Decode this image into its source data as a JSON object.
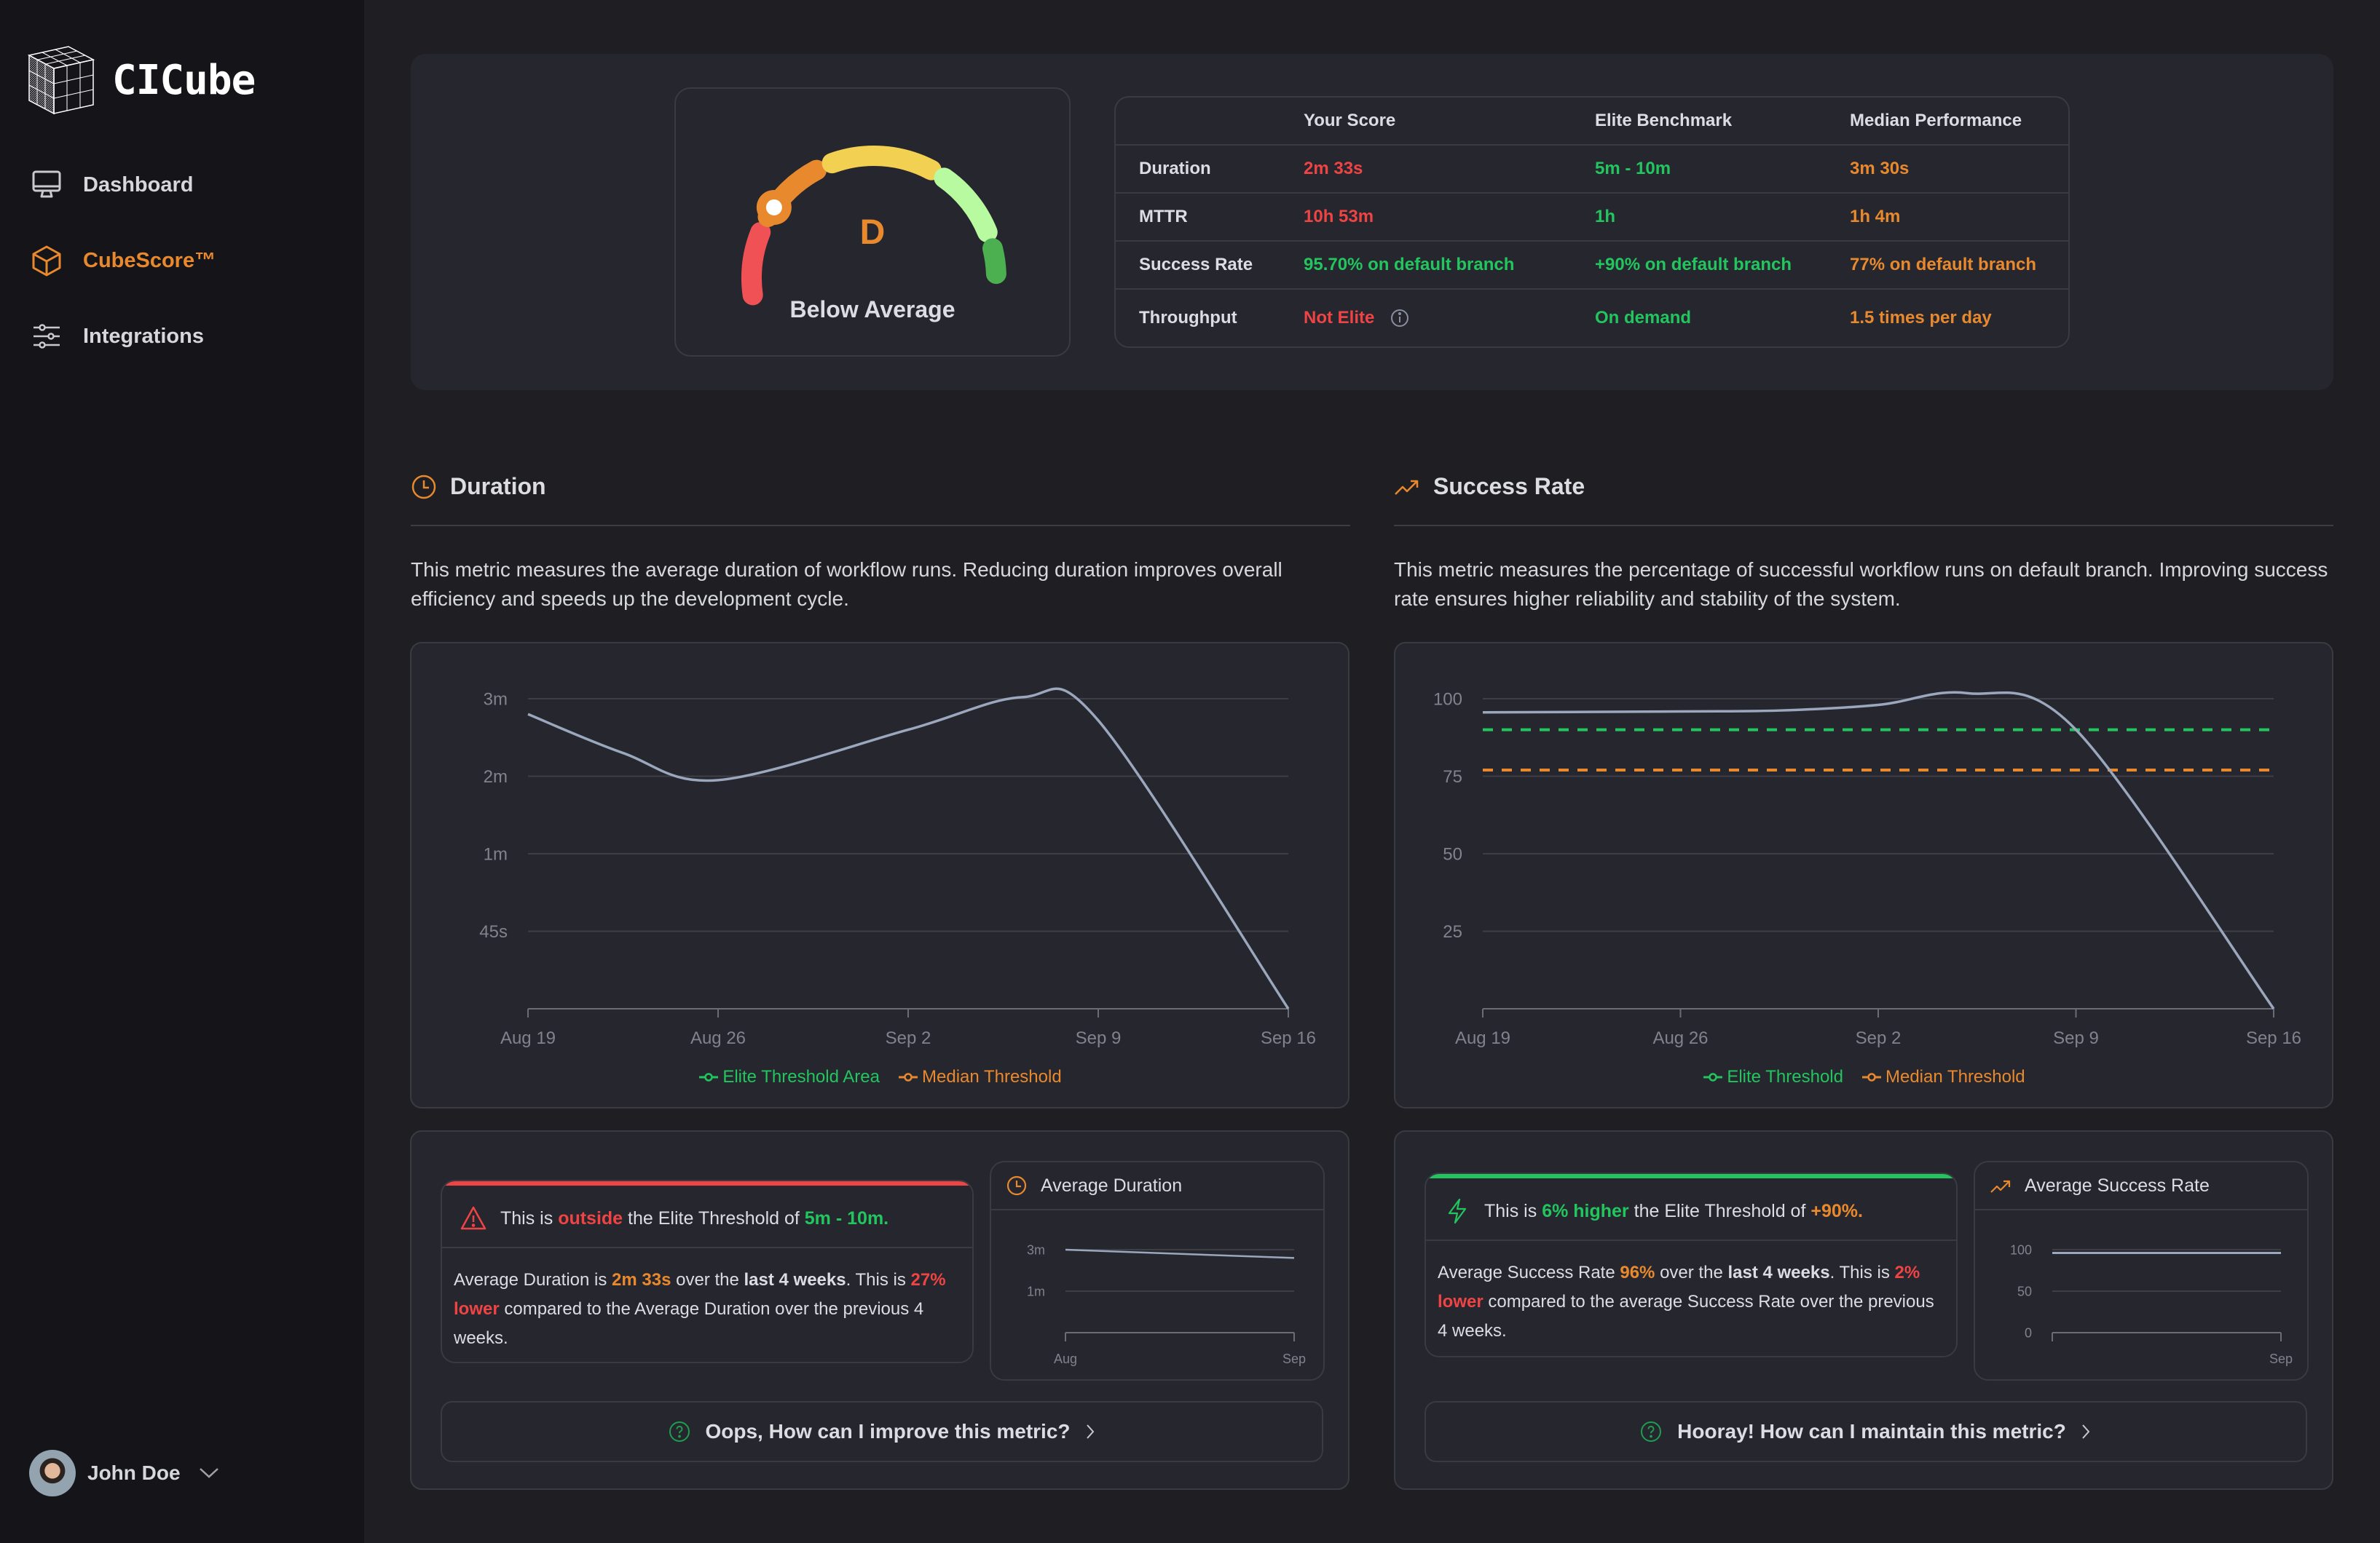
{
  "app": {
    "name": "CICube"
  },
  "sidebar": {
    "items": [
      {
        "label": "Dashboard",
        "icon": "monitor-icon",
        "active": false
      },
      {
        "label": "CubeScore™",
        "icon": "cube-icon",
        "active": true
      },
      {
        "label": "Integrations",
        "icon": "sliders-icon",
        "active": false
      }
    ],
    "user": {
      "name": "John Doe"
    }
  },
  "colors": {
    "accent": "#e8892e",
    "red": "#ef4444",
    "green": "#22c55e",
    "line": "#9aa7bd"
  },
  "score": {
    "grade": "D",
    "label": "Below Average",
    "gauge_segments": [
      {
        "name": "red",
        "color": "#ef5155"
      },
      {
        "name": "orange",
        "color": "#e8892e"
      },
      {
        "name": "yellow",
        "color": "#f2d052"
      },
      {
        "name": "light-green",
        "color": "#b7fa9f"
      },
      {
        "name": "green",
        "color": "#4caf50"
      }
    ],
    "gauge_value_fraction": 0.28,
    "table": {
      "headers": [
        "",
        "Your Score",
        "Elite Benchmark",
        "Median Performance"
      ],
      "rows": [
        {
          "metric": "Duration",
          "your": "2m 33s",
          "your_status": "red",
          "elite": "5m - 10m",
          "median": "3m 30s"
        },
        {
          "metric": "MTTR",
          "your": "10h 53m",
          "your_status": "red",
          "elite": "1h",
          "median": "1h 4m"
        },
        {
          "metric": "Success Rate",
          "your": "95.70% on default branch",
          "your_status": "green",
          "elite": "+90% on default branch",
          "median": "77% on default branch"
        },
        {
          "metric": "Throughput",
          "your": "Not Elite",
          "your_status": "red",
          "elite": "On demand",
          "median": "1.5 times per day",
          "info": true
        }
      ]
    }
  },
  "duration": {
    "title": "Duration",
    "description": "This metric measures the average duration of workflow runs. Reducing duration improves overall efficiency and speeds up the development cycle.",
    "alert": {
      "prefix": "This is ",
      "highlight": "outside",
      "middle": " the Elite Threshold of ",
      "threshold": "5m - 10m.",
      "body_1": "Average Duration is ",
      "value": "2m 33s",
      "body_2": " over the ",
      "period": "last 4 weeks",
      "body_3": ". This is ",
      "change": "27% lower",
      "body_4": " compared to the Average Duration over the previous 4 weeks."
    },
    "mini": {
      "title": "Average Duration"
    },
    "help_button": "Oops, How can I improve this metric?"
  },
  "success_rate": {
    "title": "Success Rate",
    "description": "This metric measures the percentage of successful workflow runs on default branch. Improving success rate ensures higher reliability and stability of the system.",
    "alert": {
      "prefix": "This is ",
      "highlight": "6% higher",
      "middle": " the Elite Threshold of ",
      "threshold": "+90%.",
      "body_1": "Average Success Rate ",
      "value": "96%",
      "body_2": " over the ",
      "period": "last 4 weeks",
      "body_3": ". This is ",
      "change": "2% lower",
      "body_4": " compared to the average Success Rate over the previous 4 weeks."
    },
    "mini": {
      "title": "Average Success Rate"
    },
    "help_button": "Hooray! How can I maintain this metric?"
  },
  "chart_data": [
    {
      "id": "duration-chart",
      "type": "line",
      "title": "Duration",
      "x": [
        "Aug 19",
        "Aug 26",
        "Sep 2",
        "Sep 9",
        "Sep 16"
      ],
      "ytick_labels": [
        "45s",
        "1m",
        "2m",
        "3m"
      ],
      "ytick_positions": [
        1,
        2,
        3,
        4
      ],
      "ylim": [
        0,
        4
      ],
      "series": [
        {
          "name": "Duration",
          "color": "#9aa7bd",
          "points": [
            [
              0,
              3.8
            ],
            [
              0.5,
              3.3
            ],
            [
              1,
              2.95
            ],
            [
              2,
              3.6
            ],
            [
              2.6,
              4.02
            ],
            [
              3,
              3.72
            ],
            [
              4,
              0
            ]
          ]
        }
      ],
      "legend": [
        {
          "label": "Elite Threshold Area",
          "color": "#22c55e"
        },
        {
          "label": "Median Threshold",
          "color": "#e8892e"
        }
      ],
      "legend_position": "bottom",
      "grid": true
    },
    {
      "id": "success-rate-chart",
      "type": "line",
      "title": "Success Rate",
      "x": [
        "Aug 19",
        "Aug 26",
        "Sep 2",
        "Sep 9",
        "Sep 16"
      ],
      "ytick_labels": [
        "25",
        "50",
        "75",
        "100"
      ],
      "ytick_positions": [
        25,
        50,
        75,
        100
      ],
      "ylim": [
        0,
        100
      ],
      "series": [
        {
          "name": "Success Rate",
          "color": "#9aa7bd",
          "points": [
            [
              0,
              95.6
            ],
            [
              1,
              95.9
            ],
            [
              1.5,
              96.2
            ],
            [
              2,
              98
            ],
            [
              2.45,
              101.8
            ],
            [
              3,
              90
            ],
            [
              4,
              0
            ]
          ]
        }
      ],
      "thresholds": [
        {
          "name": "Elite Threshold",
          "value": 90,
          "color": "#22c55e"
        },
        {
          "name": "Median Threshold",
          "value": 77,
          "color": "#e8892e"
        }
      ],
      "legend": [
        {
          "label": "Elite Threshold",
          "color": "#22c55e"
        },
        {
          "label": "Median Threshold",
          "color": "#e8892e"
        }
      ],
      "legend_position": "bottom",
      "grid": true
    },
    {
      "id": "mini-duration-chart",
      "type": "line",
      "title": "Average Duration",
      "x": [
        "Aug",
        "Sep"
      ],
      "ytick_labels": [
        "1m",
        "3m"
      ],
      "ytick_positions": [
        1,
        2
      ],
      "ylim": [
        0,
        2
      ],
      "series": [
        {
          "name": "Average Duration",
          "color": "#9aa7bd",
          "points": [
            [
              0,
              2.0
            ],
            [
              1,
              1.8
            ]
          ]
        }
      ],
      "grid": true
    },
    {
      "id": "mini-success-chart",
      "type": "line",
      "title": "Average Success Rate",
      "x": [
        "",
        "Sep"
      ],
      "ytick_labels": [
        "0",
        "50",
        "100"
      ],
      "ytick_positions": [
        0,
        50,
        100
      ],
      "ylim": [
        0,
        100
      ],
      "series": [
        {
          "name": "Average Success Rate",
          "color": "#9aa7bd",
          "points": [
            [
              0,
              96
            ],
            [
              1,
              96
            ]
          ]
        }
      ],
      "grid": true
    }
  ]
}
